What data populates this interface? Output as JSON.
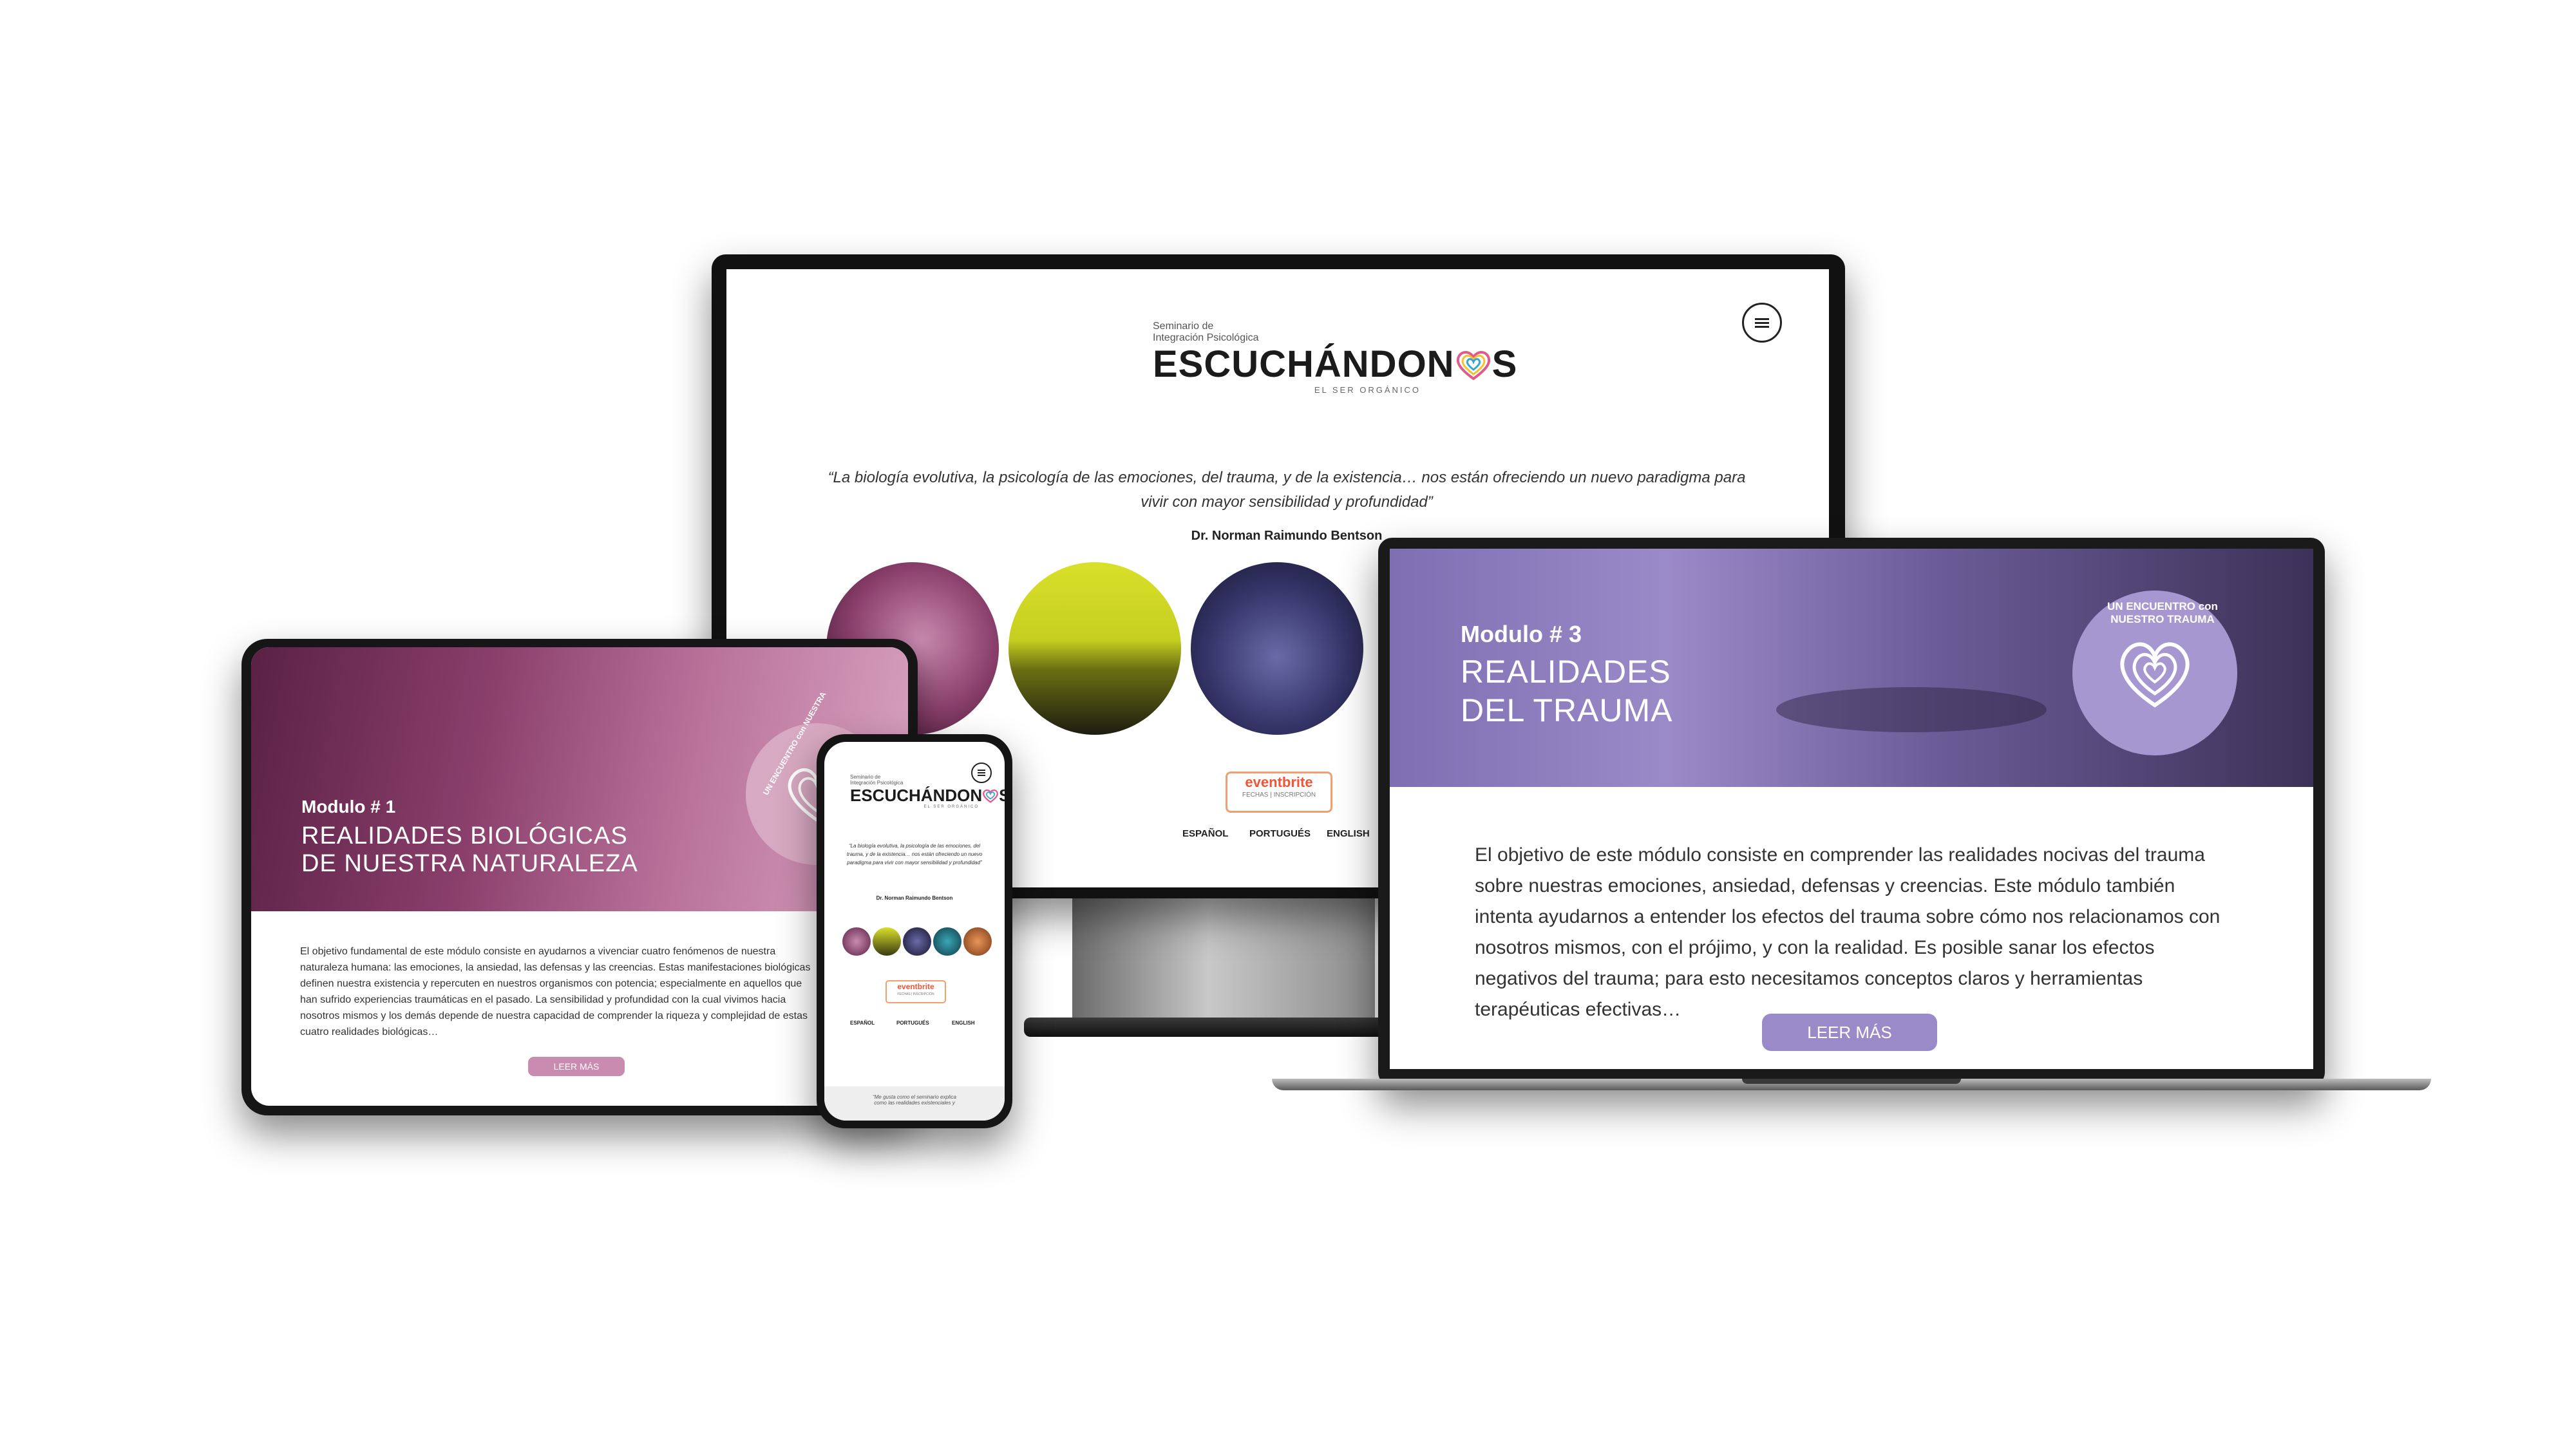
{
  "brand": {
    "pre_line1": "Seminario de",
    "pre_line2": "Integración Psicológica",
    "title_part1": "ESCUCHÁNDON",
    "title_part2": "S",
    "subtitle": "EL SER ORGÁNICO",
    "heart_colors": [
      "#e05a8a",
      "#f2c230",
      "#3aa6d8",
      "#8ac43f",
      "#9b6fc8"
    ]
  },
  "desktop": {
    "quote": "“La biología evolutiva, la psicología de las emociones, del trauma, y de la existencia… nos están ofreciendo un nuevo paradigma para vivir con mayor sensibilidad y profundidad”",
    "author": "Dr. Norman Raimundo Bentson",
    "eventbrite_label": "eventbrite",
    "eventbrite_sub": "FECHAS | INSCRIPCIÓN",
    "languages": [
      "ESPAÑOL",
      "PORTUGUÉS",
      "ENGLISH"
    ]
  },
  "tablet": {
    "module_label": "Modulo # 1",
    "module_title_line1": "REALIDADES BIOLÓGICAS",
    "module_title_line2": "DE NUESTRA NATURALEZA",
    "badge_text": "UN ENCUENTRO con NUESTRA",
    "body": "El objetivo fundamental de este módulo consiste en ayudarnos a vivenciar cuatro fenómenos de nuestra naturaleza humana: las emociones, la ansiedad, las defensas y las creencias. Estas manifestaciones biológicas definen nuestra existencia y repercuten en nuestros organismos con potencia; especialmente en aquellos que han sufrido experiencias traumáticas en el pasado. La sensibilidad y profundidad con la cual vivimos hacia nosotros mismos y los demás depende de nuestra capacidad de comprender la riqueza y complejidad de estas cuatro realidades biológicas…",
    "button": "LEER MÁS",
    "accent": "#c98bb0"
  },
  "phone": {
    "quote": "“La biología evolutiva, la psicología de las emociones, del trauma, y de la existencia… nos están ofreciendo un nuevo paradigma para vivir con mayor sensibilidad y profundidad”",
    "author": "Dr. Norman Raimundo Bentson",
    "eventbrite_label": "eventbrite",
    "eventbrite_sub": "FECHAS | INSCRIPCIÓN",
    "languages": [
      "ESPAÑOL",
      "PORTUGUÉS",
      "ENGLISH"
    ],
    "footer_text_line1": "“Me gusta como el seminario explica",
    "footer_text_line2": "como las realidades existenciales y"
  },
  "laptop": {
    "module_label": "Modulo # 3",
    "module_title_line1": "REALIDADES",
    "module_title_line2": "DEL TRAUMA",
    "badge_text": "UN ENCUENTRO con NUESTRO TRAUMA",
    "body": "El objetivo de este módulo consiste en comprender las realidades nocivas del trauma sobre nuestras emociones, ansiedad, defensas y creencias. Este módulo también intenta ayudarnos a entender los efectos del trauma sobre cómo nos relacionamos con nosotros mismos, con el prójimo, y con la realidad. Es posible sanar los efectos negativos del trauma; para esto necesitamos conceptos claros y herramientas terapéuticas efectivas…",
    "button": "LEER MÁS",
    "accent": "#9b8ac8"
  }
}
